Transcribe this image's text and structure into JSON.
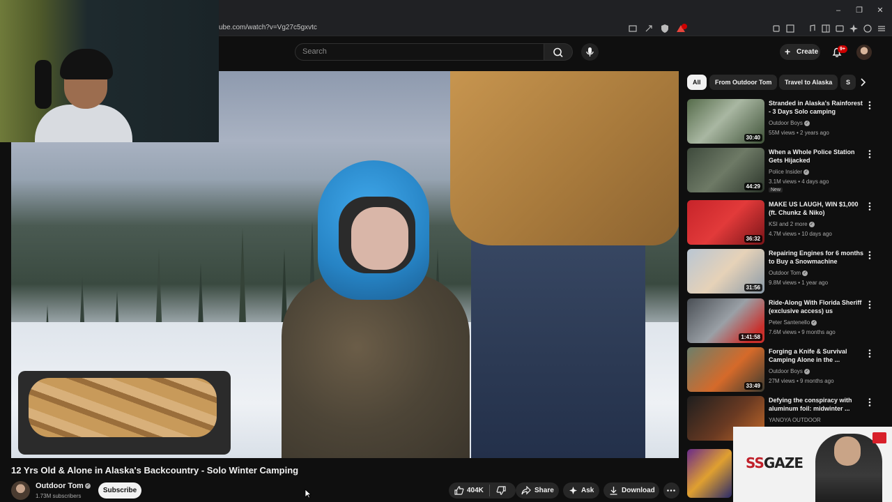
{
  "browser": {
    "url": "ube.com/watch?v=Vg27c5gxvtc",
    "extension_badge": "9"
  },
  "header": {
    "search_placeholder": "Search",
    "create_label": "Create",
    "notification_count": "9+"
  },
  "video": {
    "title": "12 Yrs Old & Alone in Alaska's Backcountry - Solo Winter Camping",
    "channel": "Outdoor Tom",
    "subscribers": "1.73M subscribers",
    "subscribe_label": "Subscribe",
    "likes": "404K",
    "share_label": "Share",
    "ask_label": "Ask",
    "download_label": "Download"
  },
  "chips": [
    "All",
    "From Outdoor Tom",
    "Travel to Alaska",
    "S"
  ],
  "recommendations": [
    {
      "title": "Stranded in Alaska's Rainforest - 3 Days Solo camping",
      "channel": "Outdoor Boys",
      "verified": true,
      "meta": "55M views • 2 years ago",
      "duration": "30:40",
      "badge": ""
    },
    {
      "title": "When a Whole Police Station Gets Hijacked",
      "channel": "Police Insider",
      "verified": true,
      "meta": "3.1M views • 4 days ago",
      "duration": "44:29",
      "badge": "New"
    },
    {
      "title": "MAKE US LAUGH, WIN $1,000 (ft. Chunkz & Niko)",
      "channel": "KSI and 2 more",
      "verified": true,
      "meta": "4.7M views • 10 days ago",
      "duration": "36:32",
      "badge": ""
    },
    {
      "title": "Repairing Engines for 6 months to Buy a Snowmachine",
      "channel": "Outdoor Tom",
      "verified": true,
      "meta": "9.8M views • 1 year ago",
      "duration": "31:56",
      "badge": ""
    },
    {
      "title": "Ride-Along With Florida Sheriff (exclusive access) us",
      "channel": "Peter Santenello",
      "verified": true,
      "meta": "7.6M views • 9 months ago",
      "duration": "1:41:58",
      "badge": ""
    },
    {
      "title": "Forging a Knife & Survival Camping Alone in the ...",
      "channel": "Outdoor Boys",
      "verified": true,
      "meta": "27M views • 9 months ago",
      "duration": "33:49",
      "badge": ""
    },
    {
      "title": "Defying the conspiracy with aluminum foil: midwinter ...",
      "channel": "YANOYA OUTDOOR",
      "verified": false,
      "meta": "",
      "duration": "",
      "badge": ""
    }
  ],
  "overlay": {
    "brand_ss": "SS",
    "brand_rest": "GAZE"
  },
  "colors": {
    "background": "#0f0f0f",
    "accent_red": "#cc0000",
    "chip_bg": "#272727"
  }
}
